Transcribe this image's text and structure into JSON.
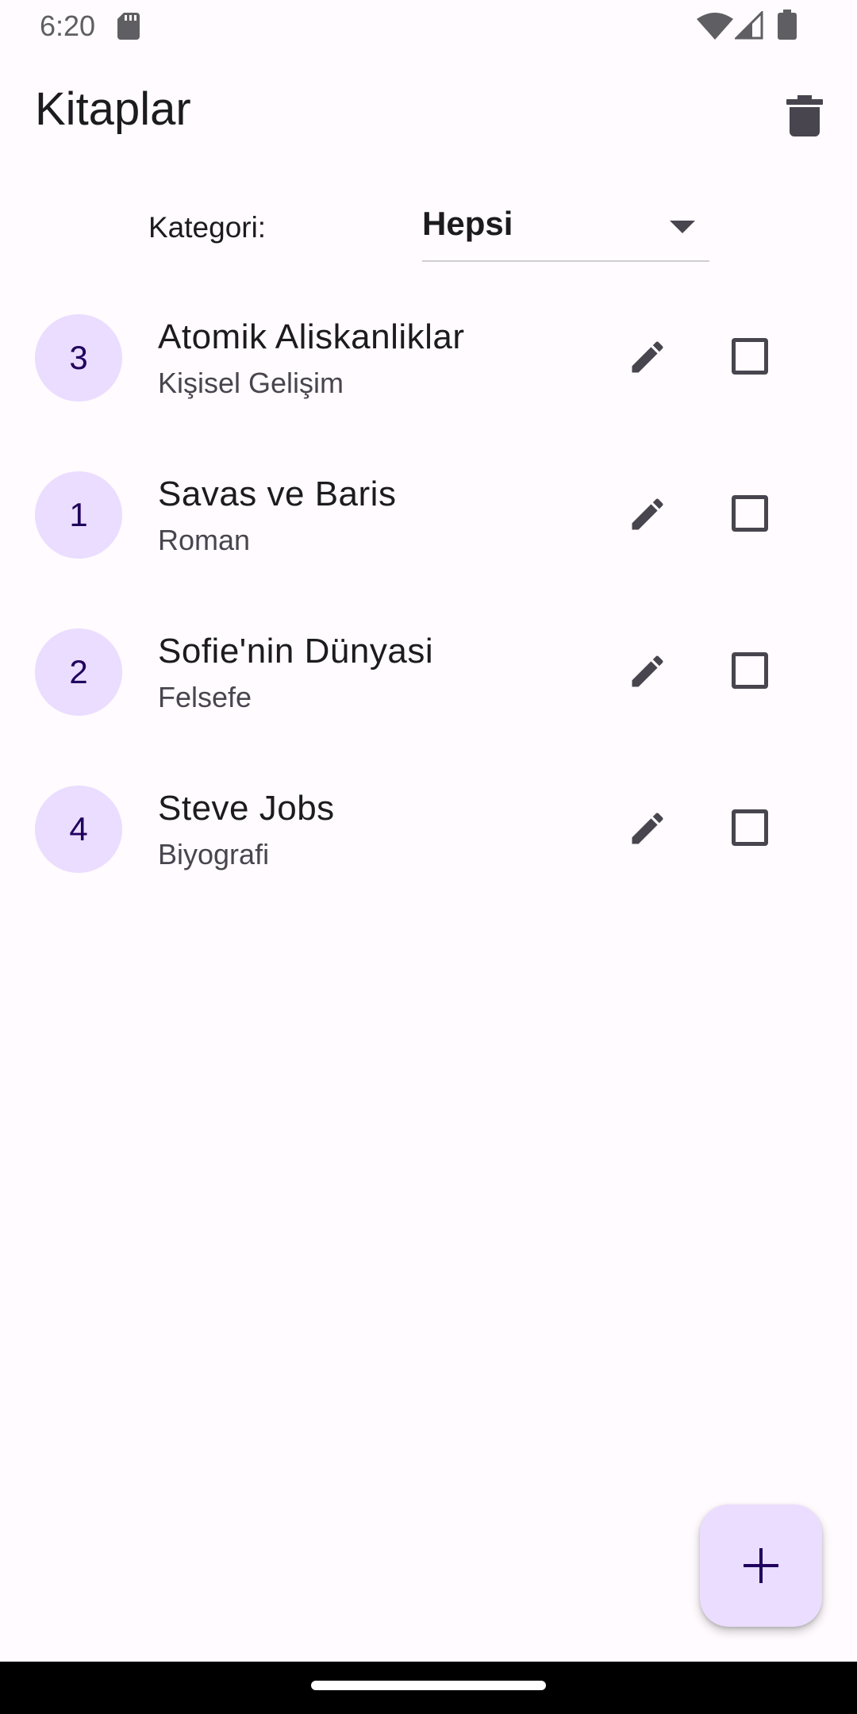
{
  "status_bar": {
    "time": "6:20"
  },
  "app_bar": {
    "title": "Kitaplar",
    "delete_icon": "trash-icon"
  },
  "filter": {
    "label": "Kategori:",
    "selected": "Hepsi"
  },
  "books": [
    {
      "id": "3",
      "title": "Atomik Aliskanliklar",
      "category": "Kişisel Gelişim",
      "checked": false
    },
    {
      "id": "1",
      "title": "Savas ve Baris",
      "category": "Roman",
      "checked": false
    },
    {
      "id": "2",
      "title": "Sofie'nin Dünyasi",
      "category": "Felsefe",
      "checked": false
    },
    {
      "id": "4",
      "title": "Steve Jobs",
      "category": "Biyografi",
      "checked": false
    }
  ],
  "fab": {
    "icon": "plus-icon"
  },
  "colors": {
    "background": "#fffbfe",
    "avatar_bg": "#eaddff",
    "avatar_text": "#21005d",
    "icon": "#49454f",
    "nav_bar": "#000000"
  }
}
